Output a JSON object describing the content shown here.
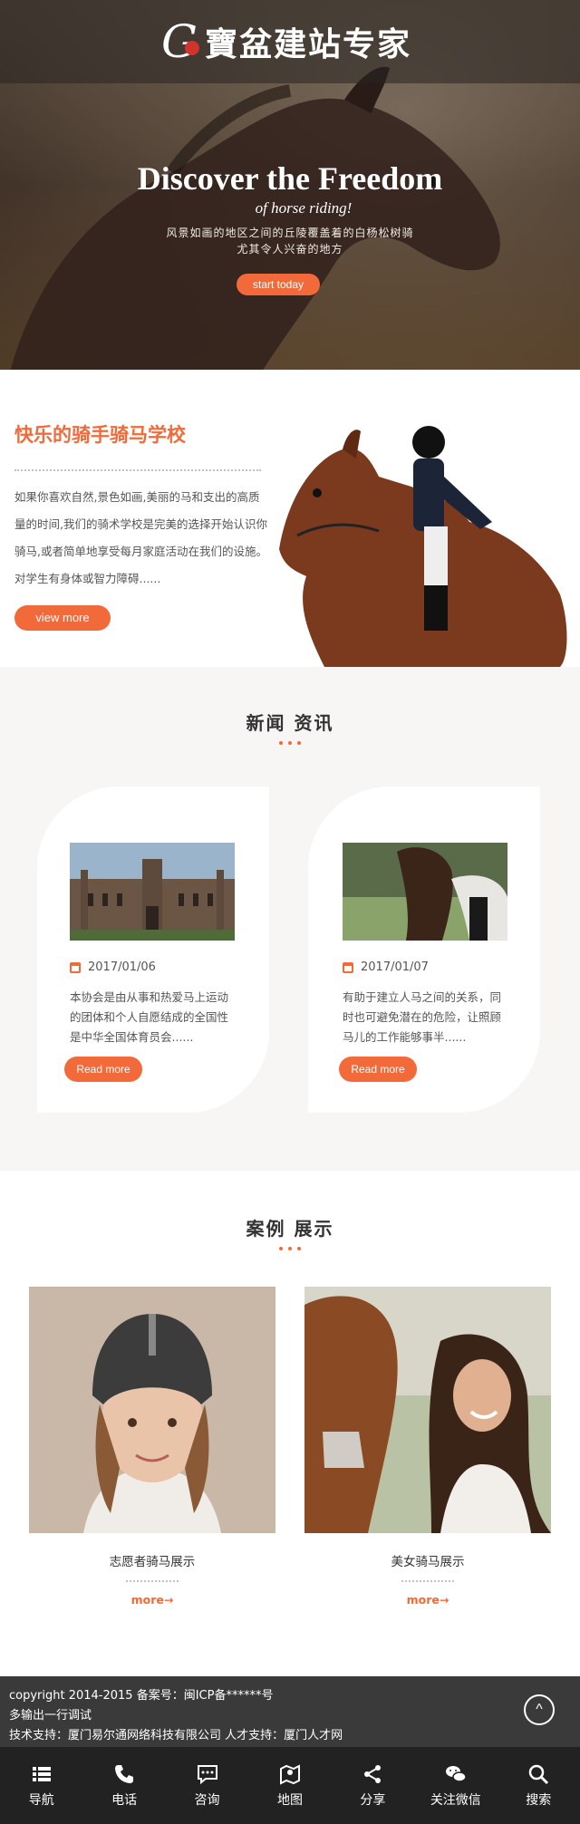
{
  "hero": {
    "logo_letter": "G",
    "logo_text": "寶盆建站专家",
    "title": "Discover the Freedom",
    "subtitle": "of horse riding!",
    "description": "风景如画的地区之间的丘陵覆盖着的白杨松树骑尤其令人兴奋的地方",
    "button": "start today"
  },
  "school": {
    "title": "快乐的骑手骑马学校",
    "text": "如果你喜欢自然,景色如画,美丽的马和支出的高质量的时间,我们的骑术学校是完美的选择开始认识你骑马,或者简单地享受每月家庭活动在我们的设施。对学生有身体或智力障碍......",
    "button": "view more"
  },
  "news": {
    "title": "新闻 资讯",
    "items": [
      {
        "date": "2017/01/06",
        "desc": "本协会是由从事和热爱马上运动的团体和个人自愿结成的全国性是中华全国体育员会......",
        "button": "Read more"
      },
      {
        "date": "2017/01/07",
        "desc": "有助于建立人马之间的关系，同时也可避免潜在的危险，让照顾马儿的工作能够事半......",
        "button": "Read more"
      }
    ]
  },
  "cases": {
    "title": "案例 展示",
    "items": [
      {
        "name": "志愿者骑马展示",
        "more": "more→"
      },
      {
        "name": "美女骑马展示",
        "more": "more→"
      }
    ]
  },
  "footer": {
    "line1": "copyright 2014-2015 备案号：闽ICP备******号",
    "line2": "多输出一行调试",
    "line3": "技术支持：厦门易尔通网络科技有限公司 人才支持：厦门人才网",
    "to_top": "^"
  },
  "nav": [
    {
      "label": "导航",
      "icon": "list-icon"
    },
    {
      "label": "电话",
      "icon": "phone-icon"
    },
    {
      "label": "咨询",
      "icon": "chat-icon"
    },
    {
      "label": "地图",
      "icon": "map-icon"
    },
    {
      "label": "分享",
      "icon": "share-icon"
    },
    {
      "label": "关注微信",
      "icon": "wechat-icon"
    },
    {
      "label": "搜索",
      "icon": "search-icon"
    }
  ],
  "colors": {
    "accent": "#f26a3a",
    "footer": "#3a3a3a",
    "nav": "#222222",
    "news_bg": "#f7f6f4"
  }
}
